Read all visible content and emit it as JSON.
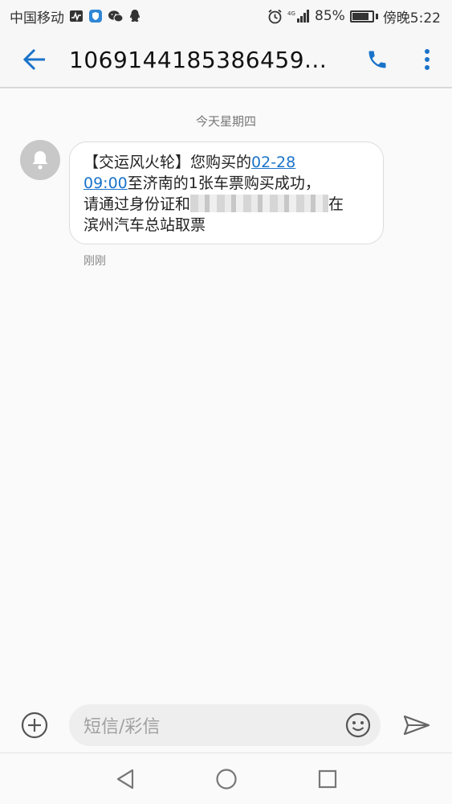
{
  "status_bar": {
    "carrier": "中国移动",
    "network": "4G",
    "battery_percent": "85%",
    "battery_level": 0.85,
    "time": "傍晚5:22"
  },
  "header": {
    "title": "1069144185386459...",
    "icons": [
      "back-arrow-icon",
      "phone-icon",
      "more-vert-icon"
    ],
    "accent_color": "#1a73c9"
  },
  "conversation": {
    "date_label": "今天星期四",
    "messages": [
      {
        "line1_prefix": "【交运风火轮】您购买的",
        "line1_link": "02-28",
        "line2_link": "09:00",
        "line2_rest": "至济南的1张车票购买成功，",
        "line3_prefix": "请通过身份证和",
        "line3_suffix": "在",
        "line4": "滨州汽车总站取票",
        "time": "刚刚"
      }
    ]
  },
  "input_bar": {
    "placeholder": "短信/彩信"
  },
  "nav_bar": {
    "buttons": [
      "back",
      "home",
      "recents"
    ]
  }
}
